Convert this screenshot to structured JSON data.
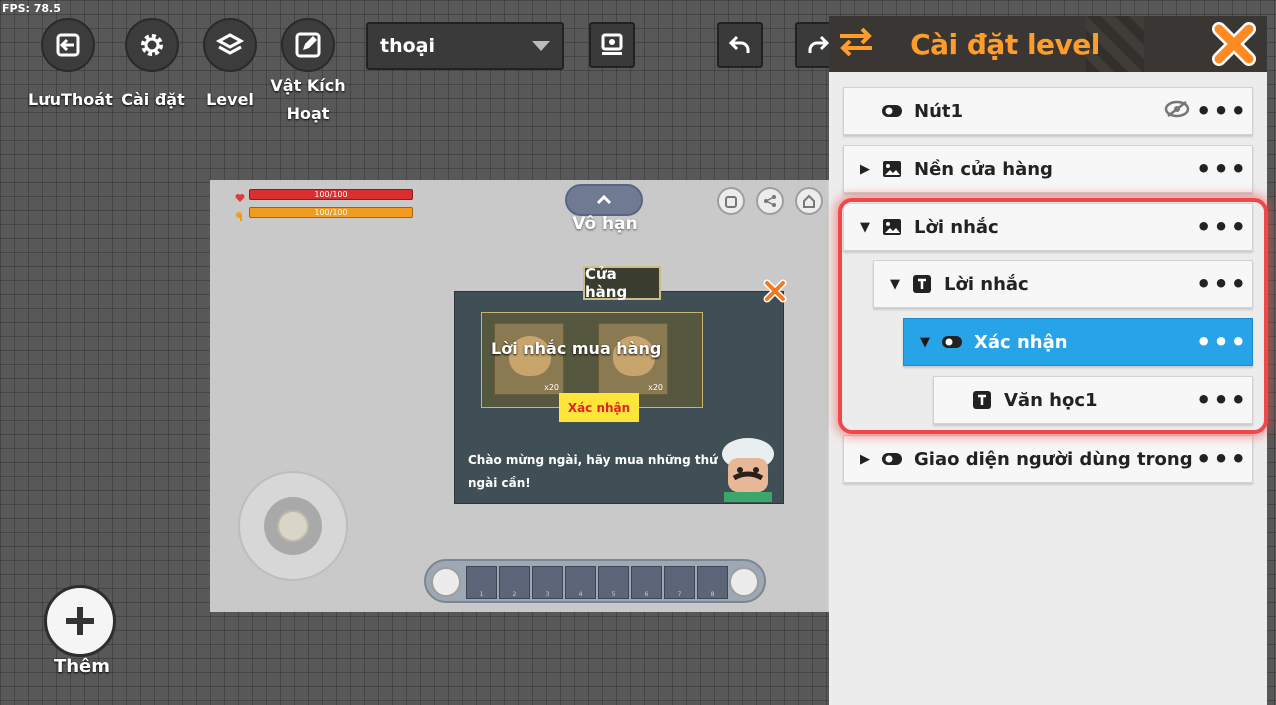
{
  "fps": "FPS: 78.5",
  "toolbar": {
    "exit_label": "LưuThoát",
    "settings_label": "Cài đặt",
    "level_label": "Level",
    "trigger_label_line1": "Vật Kích",
    "trigger_label_line2": "Hoạt",
    "dropdown_value": "thoại"
  },
  "game": {
    "health": "100/100",
    "hunger": "100/100",
    "mode_label": "Vô hạn",
    "shop_title": "Cửa hàng",
    "prompt_title": "Lời nhắc mua hàng",
    "item_qty_1": "x20",
    "item_qty_2": "x20",
    "confirm_label": "Xác nhận",
    "shop_message": "Chào mừng ngài, hãy mua những thứ ngài cần!",
    "hotbar_slots": [
      "1",
      "2",
      "3",
      "4",
      "5",
      "6",
      "7",
      "8"
    ]
  },
  "add_label": "Thêm",
  "panel": {
    "title": "Cài đặt level",
    "rows": [
      {
        "label": "Nút1"
      },
      {
        "label": "Nền cửa hàng"
      },
      {
        "label": "Lời nhắc"
      },
      {
        "label": "Lời nhắc"
      },
      {
        "label": "Xác nhận"
      },
      {
        "label": "Văn học1"
      },
      {
        "label": "Giao diện người dùng trong t"
      }
    ],
    "more_label": "•••"
  },
  "colors": {
    "accent": "#ff9d2c",
    "selected": "#27a3e8",
    "highlight": "#f04848"
  }
}
